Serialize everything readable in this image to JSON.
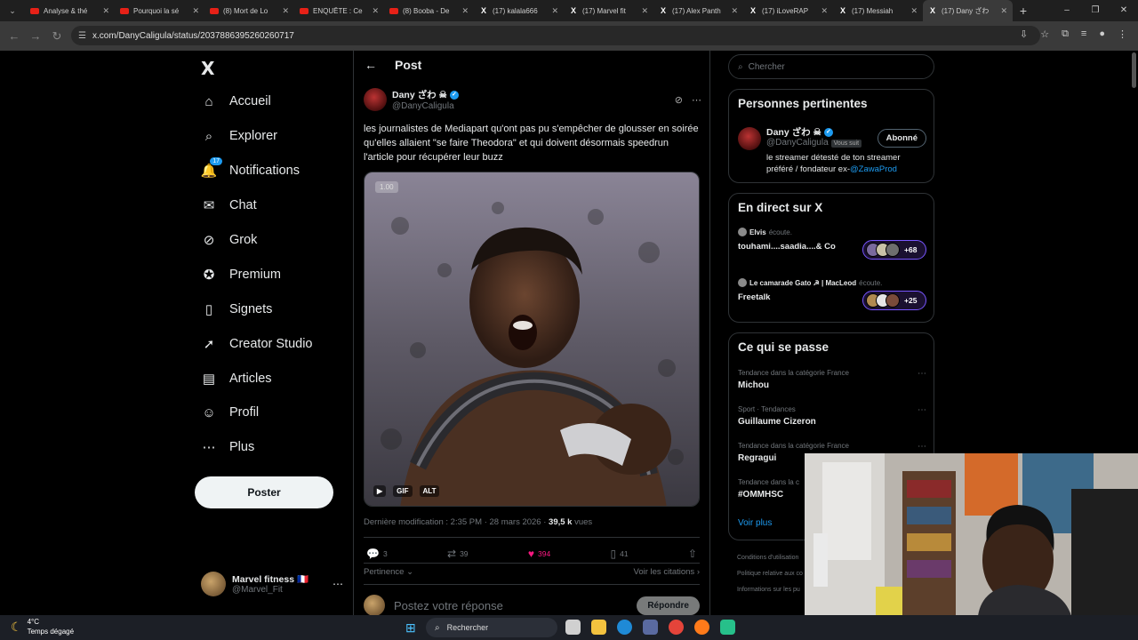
{
  "browser": {
    "tabs": [
      {
        "title": "Analyse & thé",
        "kind": "yt"
      },
      {
        "title": "Pourquoi la sé",
        "kind": "yt"
      },
      {
        "title": "(8) Mort de Lo",
        "kind": "yt"
      },
      {
        "title": "ENQUÊTE : Ce",
        "kind": "yt"
      },
      {
        "title": "(8) Booba - De",
        "kind": "yt"
      },
      {
        "title": "(17) kalala666",
        "kind": "x"
      },
      {
        "title": "(17) Marvel fit",
        "kind": "x"
      },
      {
        "title": "(17) Alex Panth",
        "kind": "x"
      },
      {
        "title": "(17) iLoveRAP",
        "kind": "x"
      },
      {
        "title": "(17) Messiah",
        "kind": "x"
      },
      {
        "title": "(17) Dany ざわ",
        "kind": "x",
        "active": true
      }
    ],
    "url": "x.com/DanyCaligula/status/2037886395260260717"
  },
  "sidebar": {
    "logo": "X",
    "items": [
      {
        "label": "Accueil",
        "icon": "home-icon",
        "glyph": "⌂"
      },
      {
        "label": "Explorer",
        "icon": "search-icon",
        "glyph": "⌕"
      },
      {
        "label": "Notifications",
        "icon": "bell-icon",
        "glyph": "🔔",
        "badge": "17"
      },
      {
        "label": "Chat",
        "icon": "mail-icon",
        "glyph": "✉"
      },
      {
        "label": "Grok",
        "icon": "grok-icon",
        "glyph": "⊘"
      },
      {
        "label": "Premium",
        "icon": "premium-icon",
        "glyph": "✪"
      },
      {
        "label": "Signets",
        "icon": "bookmark-icon",
        "glyph": "▯"
      },
      {
        "label": "Creator Studio",
        "icon": "rocket-icon",
        "glyph": "➚"
      },
      {
        "label": "Articles",
        "icon": "article-icon",
        "glyph": "▤"
      },
      {
        "label": "Profil",
        "icon": "user-icon",
        "glyph": "☺"
      },
      {
        "label": "Plus",
        "icon": "more-circle-icon",
        "glyph": "⋯"
      }
    ],
    "post_button": "Poster",
    "account": {
      "name": "Marvel fitness 🇫🇷",
      "handle": "@Marvel_Fit"
    }
  },
  "post": {
    "header_title": "Post",
    "author_name": "Dany ざわ ☠",
    "author_handle": "@DanyCaligula",
    "text": "les journalistes de Mediapart qu'ont pas pu s'empêcher de glousser en soirée qu'elles allaient \"se faire Theodora\" et qui doivent désormais speedrun l'article pour récupérer leur buzz",
    "media_duration": "1.00",
    "media_badges": [
      "GIF",
      "ALT"
    ],
    "meta_prefix": "Dernière modification : 2:35 PM · 28 mars 2026 · ",
    "views_count": "39,5 k",
    "views_label": " vues",
    "replies": "3",
    "reposts": "39",
    "likes": "394",
    "bookmarks": "41",
    "sort_label": "Pertinence",
    "quotes_label": "Voir les citations",
    "reply_placeholder": "Postez votre réponse",
    "reply_button": "Répondre"
  },
  "right": {
    "search_placeholder": "Chercher",
    "relevant_title": "Personnes pertinentes",
    "relevant_user": {
      "name": "Dany ざわ ☠",
      "handle": "@DanyCaligula",
      "follows_you": "Vous suit",
      "follow_button": "Abonné",
      "bio_prefix": "le streamer détesté de ton streamer préféré / fondateur ex-",
      "bio_link": "@ZawaProd"
    },
    "live_title": "En direct sur X",
    "live": [
      {
        "host": "Elvis",
        "listening": "écoute.",
        "title": "touhami....saadia....& Co",
        "count": "+68"
      },
      {
        "host": "Le camarade Gato ☭ | MacLeod",
        "listening": "écoute.",
        "title": "Freetalk",
        "count": "+25"
      }
    ],
    "trends_title": "Ce qui se passe",
    "trends": [
      {
        "category": "Tendance dans la catégorie France",
        "name": "Michou"
      },
      {
        "category": "Sport · Tendances",
        "name": "Guillaume Cizeron"
      },
      {
        "category": "Tendance dans la catégorie France",
        "name": "Regragui"
      },
      {
        "category": "Tendance dans la c",
        "name": "#OMMHSC"
      }
    ],
    "see_more": "Voir plus",
    "footer": [
      "Conditions d'utilisation",
      "Politique relative aux co",
      "Informations sur les pu"
    ]
  },
  "taskbar": {
    "temp": "4°C",
    "weather": "Temps dégagé",
    "search": "Rechercher"
  }
}
